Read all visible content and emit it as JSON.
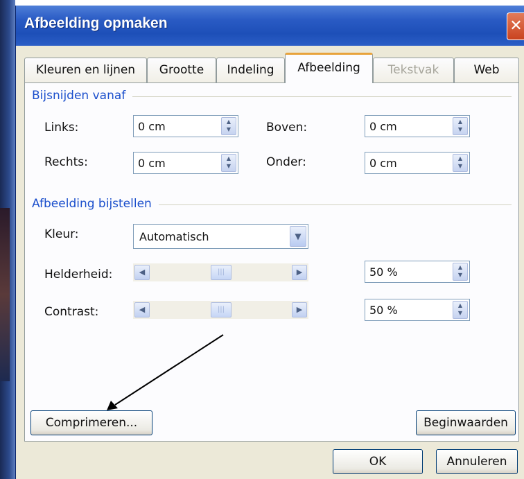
{
  "window": {
    "title": "Afbeelding opmaken",
    "close_glyph": "✕"
  },
  "tabs": [
    {
      "label": "Kleuren en lijnen",
      "state": "normal"
    },
    {
      "label": "Grootte",
      "state": "normal"
    },
    {
      "label": "Indeling",
      "state": "normal"
    },
    {
      "label": "Afbeelding",
      "state": "active"
    },
    {
      "label": "Tekstvak",
      "state": "disabled"
    },
    {
      "label": "Web",
      "state": "normal"
    }
  ],
  "crop": {
    "group_title": "Bijsnijden vanaf",
    "left_label": "Links:",
    "left_value": "0 cm",
    "top_label": "Boven:",
    "top_value": "0 cm",
    "right_label": "Rechts:",
    "right_value": "0 cm",
    "bottom_label": "Onder:",
    "bottom_value": "0 cm"
  },
  "adjust": {
    "group_title": "Afbeelding bijstellen",
    "color_label": "Kleur:",
    "color_value": "Automatisch",
    "brightness_label": "Helderheid:",
    "brightness_value": "50 %",
    "brightness_level": 0.5,
    "contrast_label": "Contrast:",
    "contrast_value": "50 %",
    "contrast_level": 0.5
  },
  "buttons": {
    "compress": "Comprimeren...",
    "reset": "Beginwaarden",
    "ok": "OK",
    "cancel": "Annuleren"
  },
  "colors": {
    "titlebar": "#2a5bc4",
    "group_title": "#1b4fcc",
    "active_tab_accent": "#e8a33b",
    "dialog_bg": "#ece9d8"
  },
  "icons": {
    "spin": "spin-up-down-icon",
    "dropdown": "chevron-down-icon",
    "slider_left": "arrow-left-icon",
    "slider_right": "arrow-right-icon",
    "annotation": "annotation-arrow-icon"
  }
}
